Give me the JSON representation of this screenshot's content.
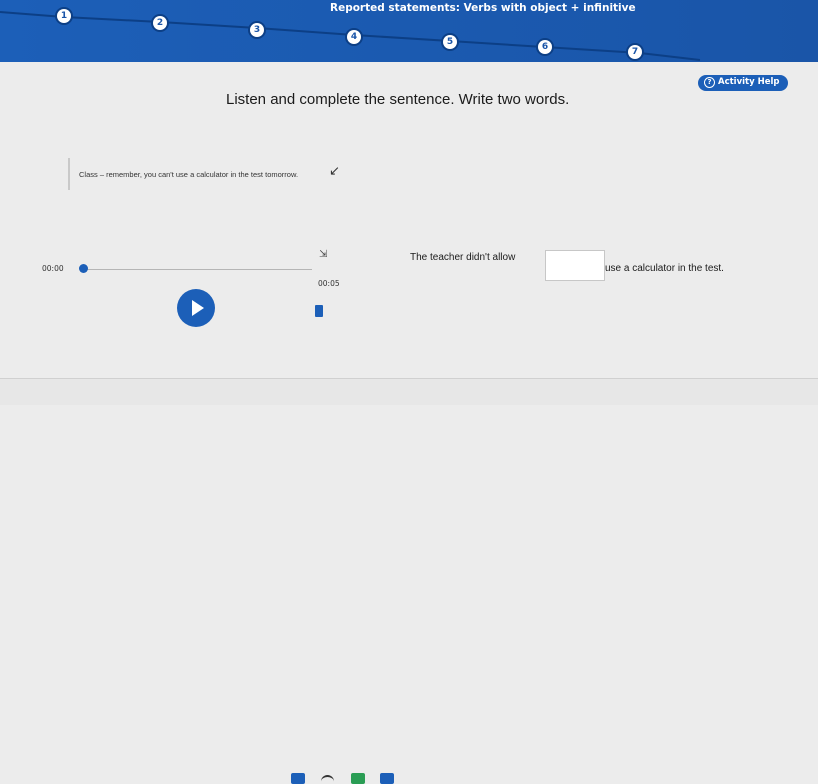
{
  "header": {
    "title": "Reported statements: Verbs with object + infinitive",
    "steps": [
      "1",
      "2",
      "3",
      "4",
      "5",
      "6",
      "7"
    ]
  },
  "help": {
    "label": "Activity Help",
    "icon": "help-circle-icon"
  },
  "instruction": "Listen and complete the sentence. Write two words.",
  "transcript": {
    "text": "Class – remember, you can't use a calculator in the test tomorrow."
  },
  "audio": {
    "current_time": "00:00",
    "duration": "00:05",
    "progress": 0
  },
  "question": {
    "before": "The teacher didn't allow",
    "after": "use a calculator in the test.",
    "answer_value": ""
  },
  "colors": {
    "accent": "#1c5fb8",
    "background": "#ececec"
  }
}
